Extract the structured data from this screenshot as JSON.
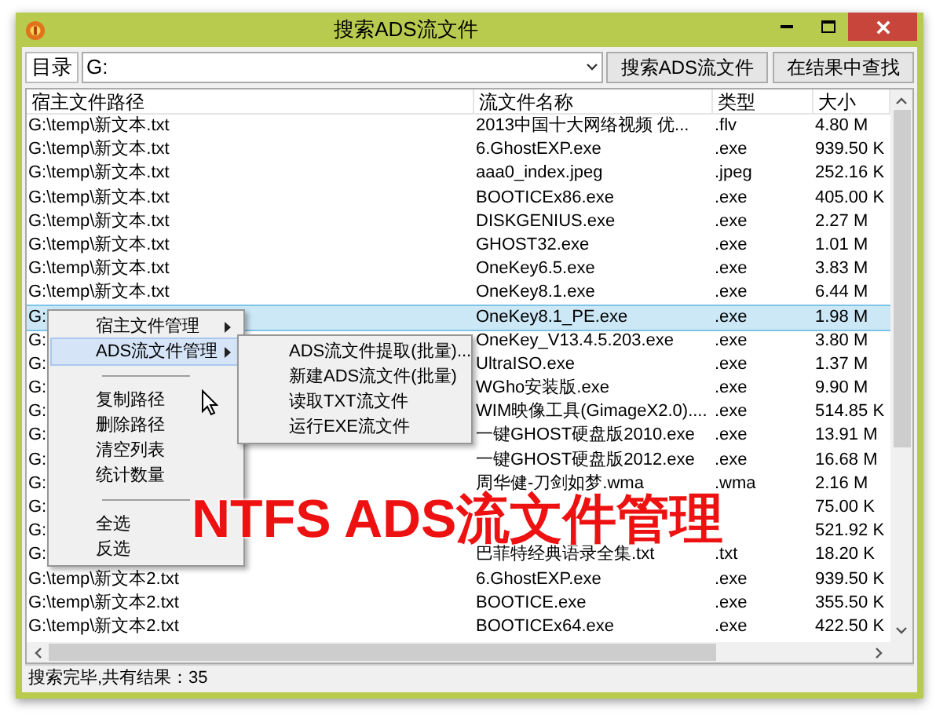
{
  "window": {
    "title": "搜索ADS流文件"
  },
  "toolbar": {
    "label": "目录",
    "path_value": "G:",
    "buttons": [
      "搜索ADS流文件",
      "在结果中查找"
    ]
  },
  "table": {
    "columns": [
      "宿主文件路径",
      "流文件名称",
      "类型",
      "大小"
    ],
    "rows": [
      {
        "path": "G:\\temp\\新文本.txt",
        "name": "2013中国十大网络视频 优...",
        "type": ".flv",
        "size": "4.80 M",
        "selected": false
      },
      {
        "path": "G:\\temp\\新文本.txt",
        "name": "6.GhostEXP.exe",
        "type": ".exe",
        "size": "939.50 K",
        "selected": false
      },
      {
        "path": "G:\\temp\\新文本.txt",
        "name": "aaa0_index.jpeg",
        "type": ".jpeg",
        "size": "252.16 K",
        "selected": false
      },
      {
        "path": "G:\\temp\\新文本.txt",
        "name": "BOOTICEx86.exe",
        "type": ".exe",
        "size": "405.00 K",
        "selected": false
      },
      {
        "path": "G:\\temp\\新文本.txt",
        "name": "DISKGENIUS.exe",
        "type": ".exe",
        "size": "2.27 M",
        "selected": false
      },
      {
        "path": "G:\\temp\\新文本.txt",
        "name": "GHOST32.exe",
        "type": ".exe",
        "size": "1.01 M",
        "selected": false
      },
      {
        "path": "G:\\temp\\新文本.txt",
        "name": "OneKey6.5.exe",
        "type": ".exe",
        "size": "3.83 M",
        "selected": false
      },
      {
        "path": "G:\\temp\\新文本.txt",
        "name": "OneKey8.1.exe",
        "type": ".exe",
        "size": "6.44 M",
        "selected": false
      },
      {
        "path": "G:",
        "name": "OneKey8.1_PE.exe",
        "type": ".exe",
        "size": "1.98 M",
        "selected": true
      },
      {
        "path": "G:",
        "name": "OneKey_V13.4.5.203.exe",
        "type": ".exe",
        "size": "3.80 M",
        "selected": false
      },
      {
        "path": "G:",
        "name": "UltraISO.exe",
        "type": ".exe",
        "size": "1.37 M",
        "selected": false
      },
      {
        "path": "G:",
        "name": "WGho安装版.exe",
        "type": ".exe",
        "size": "9.90 M",
        "selected": false
      },
      {
        "path": "G:",
        "name": "WIM映像工具(GimageX2.0)....",
        "type": ".exe",
        "size": "514.85 K",
        "selected": false
      },
      {
        "path": "G:",
        "name": "一键GHOST硬盘版2010.exe",
        "type": ".exe",
        "size": "13.91 M",
        "selected": false
      },
      {
        "path": "G:",
        "name": "一键GHOST硬盘版2012.exe",
        "type": ".exe",
        "size": "16.68 M",
        "selected": false
      },
      {
        "path": "G:",
        "name": "周华健-刀剑如梦.wma",
        "type": ".wma",
        "size": "2.16 M",
        "selected": false
      },
      {
        "path": "G:",
        "size": "75.00 K",
        "selected": false
      },
      {
        "path": "G:",
        "size": "521.92 K",
        "selected": false
      },
      {
        "path": "G:",
        "name": "巴菲特经典语录全集.txt",
        "type": ".txt",
        "size": "18.20 K",
        "selected": false
      },
      {
        "path": "G:\\temp\\新文本2.txt",
        "name": "6.GhostEXP.exe",
        "type": ".exe",
        "size": "939.50 K",
        "selected": false
      },
      {
        "path": "G:\\temp\\新文本2.txt",
        "name": "BOOTICE.exe",
        "type": ".exe",
        "size": "355.50 K",
        "selected": false
      },
      {
        "path": "G:\\temp\\新文本2.txt",
        "name": "BOOTICEx64.exe",
        "type": ".exe",
        "size": "422.50 K",
        "selected": false
      }
    ]
  },
  "status_bar": "搜索完毕,共有结果：35",
  "context_menu": {
    "items": [
      {
        "kind": "submenu",
        "label": "宿主文件管理",
        "selected": false
      },
      {
        "kind": "submenu",
        "label": "ADS流文件管理",
        "selected": true
      },
      {
        "kind": "separator"
      },
      {
        "kind": "item",
        "label": "复制路径",
        "selected": false
      },
      {
        "kind": "item",
        "label": "删除路径",
        "selected": false
      },
      {
        "kind": "item",
        "label": "清空列表",
        "selected": false
      },
      {
        "kind": "item",
        "label": "统计数量",
        "selected": false
      },
      {
        "kind": "separator"
      },
      {
        "kind": "item",
        "label": "全选",
        "selected": false
      },
      {
        "kind": "item",
        "label": "反选",
        "selected": false
      }
    ]
  },
  "submenu": {
    "items": [
      "ADS流文件提取(批量)...",
      "新建ADS流文件(批量)",
      "读取TXT流文件",
      "运行EXE流文件"
    ]
  },
  "overlay_title": "NTFS ADS流文件管理"
}
